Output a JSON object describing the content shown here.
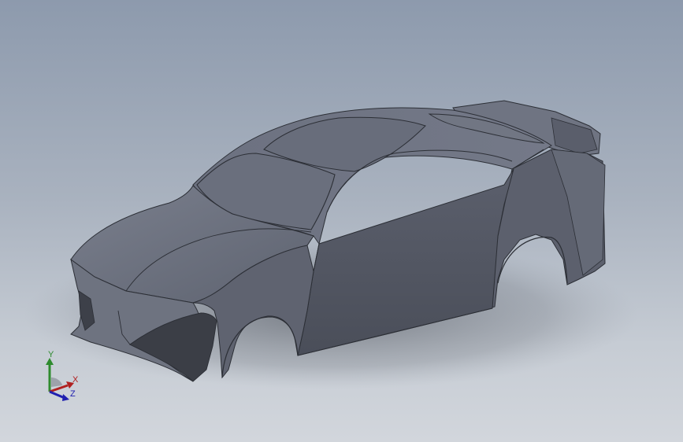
{
  "viewport": {
    "background_top": "#8d9aad",
    "background_bottom": "#d2d6dc",
    "model_color": "#5d616f"
  },
  "model": {
    "name_icon": "car-body-shell-model"
  },
  "triad": {
    "x_label": "X",
    "y_label": "Y",
    "z_label": "Z",
    "x_color": "#b02020",
    "y_color": "#2e8b2e",
    "z_color": "#2020b0"
  }
}
